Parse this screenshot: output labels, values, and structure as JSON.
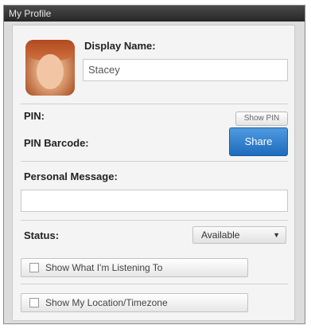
{
  "window": {
    "title": "My Profile"
  },
  "profile": {
    "display_name_label": "Display Name:",
    "display_name_value": "Stacey",
    "pin_label": "PIN:",
    "pin_button_label": "Show PIN",
    "pin_barcode_label": "PIN Barcode:",
    "share_button_label": "Share",
    "personal_message_label": "Personal Message:",
    "personal_message_value": "",
    "status_label": "Status:",
    "status_value": "Available",
    "show_music_label": "Show What I'm Listening To",
    "show_location_label": "Show My Location/Timezone"
  },
  "colors": {
    "accent": "#1e6bbd",
    "title_bar": "#2a2a2a"
  }
}
